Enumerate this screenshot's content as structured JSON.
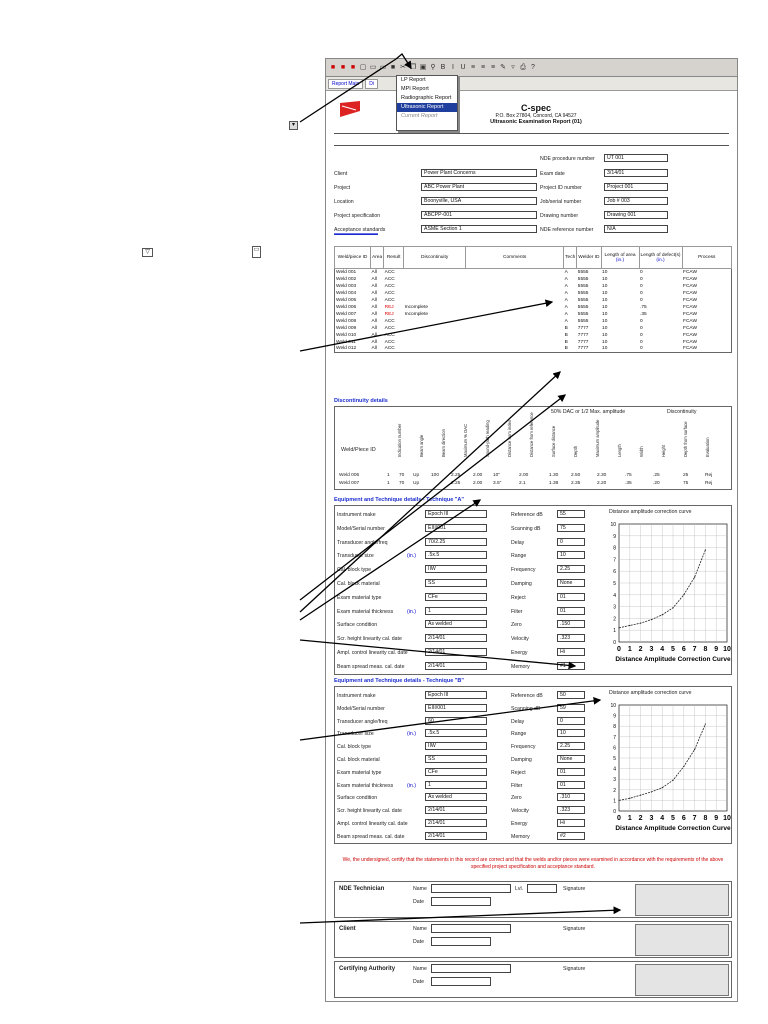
{
  "menu": {
    "items": [
      "LP Report",
      "MPI Report",
      "Radiographic Report",
      "Ultrasonic Report",
      "Current Report"
    ],
    "selected_index": 3
  },
  "tabs": [
    "Report Main",
    "Di"
  ],
  "header": {
    "company": "C-spec",
    "address": "P.O. Box 27804, Concord, CA 94527",
    "title": "Ultrasonic Examination Report (01)"
  },
  "job": {
    "nde_proc_label": "NDE procedure number",
    "nde_proc": "UT 001",
    "left": [
      {
        "label": "Client",
        "value": "Power Plant Concerns"
      },
      {
        "label": "Project",
        "value": "ABC Power Plant"
      },
      {
        "label": "Location",
        "value": "Boonyville, USA"
      },
      {
        "label": "Project specification",
        "value": "ABCPP-001"
      },
      {
        "label": "Acceptance standards",
        "value": "ASME Section 1"
      }
    ],
    "right": [
      {
        "label": "Exam date",
        "value": "3/14/01"
      },
      {
        "label": "Project ID number",
        "value": "Project 001"
      },
      {
        "label": "Job/serial number",
        "value": "Job # 003"
      },
      {
        "label": "Drawing number",
        "value": "Drawing 001"
      },
      {
        "label": "NDE reference number",
        "value": "N/A"
      }
    ]
  },
  "welds": {
    "headers": [
      "Weld/piece ID",
      "Area",
      "Result",
      "Discontinuity",
      "Comments",
      "Tech",
      "Welder ID",
      "Length of area",
      "Length of defect(s)",
      "Process"
    ],
    "unit": "(in.)",
    "rows": [
      [
        "Weld 001",
        "All",
        "ACC",
        "",
        "",
        "A",
        "5555",
        "10",
        "0",
        "FCAW"
      ],
      [
        "Weld 002",
        "All",
        "ACC",
        "",
        "",
        "A",
        "5555",
        "10",
        "0",
        "FCAW"
      ],
      [
        "Weld 003",
        "All",
        "ACC",
        "",
        "",
        "A",
        "5555",
        "10",
        "0",
        "FCAW"
      ],
      [
        "Weld 004",
        "All",
        "ACC",
        "",
        "",
        "A",
        "5555",
        "10",
        "0",
        "FCAW"
      ],
      [
        "Weld 005",
        "All",
        "ACC",
        "",
        "",
        "A",
        "5555",
        "10",
        "0",
        "FCAW"
      ],
      [
        "Weld 006",
        "All",
        "REJ",
        "Incomplete",
        "",
        "A",
        "5555",
        "10",
        ".75",
        "FCAW"
      ],
      [
        "Weld 007",
        "All",
        "REJ",
        "Incomplete",
        "",
        "A",
        "5555",
        "10",
        ".35",
        "FCAW"
      ],
      [
        "Weld 008",
        "All",
        "ACC",
        "",
        "",
        "A",
        "5555",
        "10",
        "0",
        "FCAW"
      ],
      [
        "Weld 009",
        "All",
        "ACC",
        "",
        "",
        "B",
        "7777",
        "10",
        "0",
        "FCAW"
      ],
      [
        "Weld 010",
        "All",
        "ACC",
        "",
        "",
        "B",
        "7777",
        "10",
        "0",
        "FCAW"
      ],
      [
        "Weld 011",
        "All",
        "ACC",
        "",
        "",
        "B",
        "7777",
        "10",
        "0",
        "FCAW"
      ],
      [
        "Weld 012",
        "All",
        "ACC",
        "",
        "",
        "B",
        "7777",
        "10",
        "0",
        "FCAW"
      ]
    ]
  },
  "disc": {
    "title": "Discontinuity details",
    "rowhead": "Weld/Piece ID",
    "group1": "50% DAC or 1/2 Max. amplitude",
    "group2": "Discontinuity",
    "cols": [
      "Indication number",
      "Beam angle",
      "Beam direction",
      "Maximum % DAC",
      "Sound-path reading",
      "Distance from index",
      "Distance from reference",
      "Surface distance",
      "Depth",
      "Maximum amplitude",
      "Length",
      "Width",
      "Height",
      "Depth from surface",
      "Evaluation"
    ],
    "rows": [
      [
        "Weld 006",
        "1",
        "70",
        "Up",
        "100",
        "2.25",
        "2.00",
        "10\"",
        "2.00",
        "1.30",
        "2.50",
        "2.30",
        ".75",
        ".25",
        "25",
        "Rej"
      ],
      [
        "Weld 007",
        "1",
        "70",
        "Up",
        "",
        "2.25",
        "2.00",
        "3.5\"",
        "2.1",
        "1.38",
        "2.35",
        "2.20",
        ".35",
        ".20",
        "75",
        "Rej"
      ]
    ]
  },
  "techA": {
    "title": "Equipment and Technique details - Technique \"A\"",
    "left": [
      {
        "label": "Instrument make",
        "value": "Epoch III"
      },
      {
        "label": "Model/Serial number",
        "value": "EIII/001"
      },
      {
        "label": "Transducer angle/freq",
        "value": "70/2.25"
      },
      {
        "label": "Transducer size",
        "value": ".5x.5",
        "unit": "(in.)"
      },
      {
        "label": "Cal. block type",
        "value": "IIW"
      },
      {
        "label": "Cal. block material",
        "value": "SS"
      },
      {
        "label": "Exam material type",
        "value": "CFe"
      },
      {
        "label": "Exam material thickness",
        "value": "1",
        "unit": "(in.)"
      },
      {
        "label": "Surface condition",
        "value": "As welded"
      },
      {
        "label": "Scr. height linearity cal. date",
        "value": "2/14/01"
      },
      {
        "label": "Ampl. control linearity cal. date",
        "value": "2/14/01"
      },
      {
        "label": "Beam spread meas. cal. date",
        "value": "2/14/01"
      }
    ],
    "right": [
      {
        "label": "Reference dB",
        "value": "55"
      },
      {
        "label": "Scanning dB",
        "value": "75"
      },
      {
        "label": "Delay",
        "value": "0"
      },
      {
        "label": "Range",
        "value": "10"
      },
      {
        "label": "Frequency",
        "value": "2.25"
      },
      {
        "label": "Damping",
        "value": "None"
      },
      {
        "label": "Reject",
        "value": "01"
      },
      {
        "label": "Filter",
        "value": "01"
      },
      {
        "label": "Zero",
        "value": ".150"
      },
      {
        "label": "Velocity",
        "value": ".323"
      },
      {
        "label": "Energy",
        "value": "Hi"
      },
      {
        "label": "Memory",
        "value": "#1"
      }
    ],
    "chart_head": "Distance amplitude correction curve",
    "chart_title": "Distance Amplitude Correction Curve"
  },
  "techB": {
    "title": "Equipment and Technique details - Technique \"B\"",
    "left": [
      {
        "label": "Instrument make",
        "value": "Epoch III"
      },
      {
        "label": "Model/Serial number",
        "value": "EIII/001"
      },
      {
        "label": "Transducer angle/freq",
        "value": "60"
      },
      {
        "label": "Transducer size",
        "value": ".5x.5",
        "unit": "(in.)"
      },
      {
        "label": "Cal. block type",
        "value": "IIW"
      },
      {
        "label": "Cal. block material",
        "value": "SS"
      },
      {
        "label": "Exam material type",
        "value": "CFe"
      },
      {
        "label": "Exam material thickness",
        "value": "1",
        "unit": "(in.)"
      },
      {
        "label": "Surface condition",
        "value": "As welded"
      },
      {
        "label": "Scr. height linearity cal. date",
        "value": "2/14/01"
      },
      {
        "label": "Ampl. control linearity cal. date",
        "value": "2/14/01"
      },
      {
        "label": "Beam spread meas. cal. date",
        "value": "2/14/01"
      }
    ],
    "right": [
      {
        "label": "Reference dB",
        "value": "50"
      },
      {
        "label": "Scanning dB",
        "value": "59"
      },
      {
        "label": "Delay",
        "value": "0"
      },
      {
        "label": "Range",
        "value": "10"
      },
      {
        "label": "Frequency",
        "value": "2.25"
      },
      {
        "label": "Damping",
        "value": "None"
      },
      {
        "label": "Reject",
        "value": "01"
      },
      {
        "label": "Filter",
        "value": "01"
      },
      {
        "label": "Zero",
        "value": ".310"
      },
      {
        "label": "Velocity",
        "value": ".323"
      },
      {
        "label": "Energy",
        "value": "Hi"
      },
      {
        "label": "Memory",
        "value": "#2"
      }
    ],
    "chart_head": "Distance amplitude correction curve",
    "chart_title": "Distance Amplitude Correction Curve"
  },
  "chart_data": [
    {
      "type": "line",
      "title": "Distance Amplitude Correction Curve",
      "x": [
        0,
        1,
        2,
        3,
        4,
        5,
        6,
        7,
        8
      ],
      "y": [
        1.2,
        1.4,
        1.6,
        1.9,
        2.3,
        2.9,
        4.0,
        5.5,
        7.8
      ],
      "xlim": [
        0,
        10
      ],
      "ylim": [
        0,
        10
      ],
      "xticks": [
        "0",
        "1",
        "2",
        "3",
        "4",
        "5",
        "6",
        "7",
        "8",
        "9",
        "10"
      ],
      "yticks": [
        "0",
        "1",
        "2",
        "3",
        "4",
        "5",
        "6",
        "7",
        "8",
        "9",
        "10"
      ],
      "grid": true
    },
    {
      "type": "line",
      "title": "Distance Amplitude Correction Curve",
      "x": [
        0,
        1,
        2,
        3,
        4,
        5,
        6,
        7,
        8
      ],
      "y": [
        1.0,
        1.2,
        1.5,
        1.8,
        2.2,
        2.9,
        4.2,
        5.8,
        8.2
      ],
      "xlim": [
        0,
        10
      ],
      "ylim": [
        0,
        10
      ],
      "xticks": [
        "0",
        "1",
        "2",
        "3",
        "4",
        "5",
        "6",
        "7",
        "8",
        "9",
        "10"
      ],
      "yticks": [
        "0",
        "1",
        "2",
        "3",
        "4",
        "5",
        "6",
        "7",
        "8",
        "9",
        "10"
      ],
      "grid": true
    }
  ],
  "cert": "We, the undersigned, certify that the statements in this record are correct and that the welds and/or pieces were examined in accordance with the requirements of the above specified project specification and acceptance standard.",
  "sign": [
    {
      "role": "NDE Technician",
      "name_label": "Name",
      "date_label": "Date",
      "lvl_label": "Lvl.",
      "sig_label": "Signature"
    },
    {
      "role": "Client",
      "name_label": "Name",
      "date_label": "Date",
      "sig_label": "Signature"
    },
    {
      "role": "Certifying Authority",
      "name_label": "Name",
      "date_label": "Date",
      "sig_label": "Signature"
    }
  ]
}
